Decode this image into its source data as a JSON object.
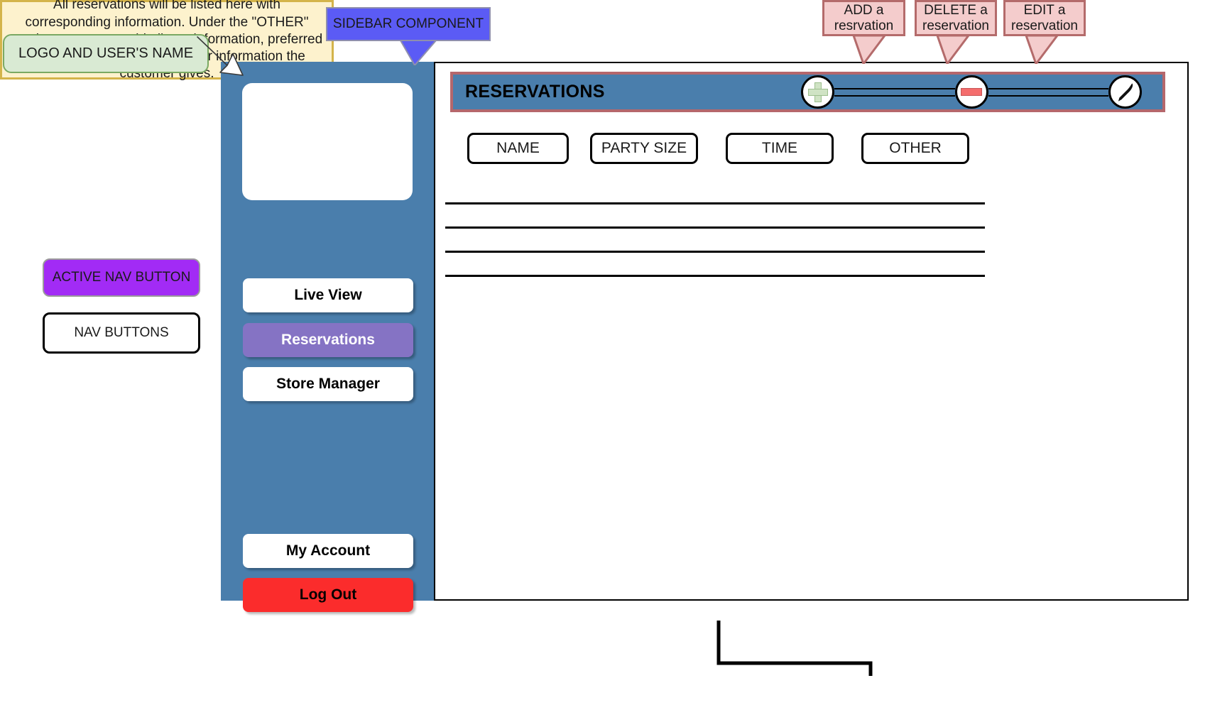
{
  "annotations": {
    "logo_label": "LOGO AND USER'S NAME",
    "sidebar_label": "SIDEBAR COMPONENT",
    "add_label": "ADD a resrvation",
    "delete_label": "DELETE a reservation",
    "edit_label": "EDIT a reservation",
    "legend_active": "ACTIVE NAV BUTTON",
    "legend_nav": "NAV BUTTONS",
    "note": "All reservations will be listed here with corresponding information. Under the \"OTHER\" section, users can add allergy information, preferred seating location, and any other information the customer gives."
  },
  "sidebar": {
    "logo_placeholder": "",
    "items": [
      {
        "label": "Live View",
        "active": false
      },
      {
        "label": "Reservations",
        "active": true
      },
      {
        "label": "Store Manager",
        "active": false
      }
    ],
    "footer_items": [
      {
        "label": "My Account",
        "style": "default"
      },
      {
        "label": "Log Out",
        "style": "logout"
      }
    ]
  },
  "main": {
    "header_title": "RESERVATIONS",
    "actions": [
      {
        "name": "add-reservation",
        "icon": "plus-icon"
      },
      {
        "name": "delete-reservation",
        "icon": "minus-icon"
      },
      {
        "name": "edit-reservation",
        "icon": "pencil-icon"
      }
    ],
    "columns": [
      {
        "label": "NAME"
      },
      {
        "label": "PARTY SIZE"
      },
      {
        "label": "TIME"
      },
      {
        "label": "OTHER"
      }
    ],
    "rows": [
      "",
      "",
      "",
      ""
    ]
  },
  "colors": {
    "sidebar_blue": "#4a7eac",
    "active_nav_purple": "#8573c4",
    "legend_purple": "#a22bf5",
    "logout_red": "#fb2c2c",
    "header_border_rose": "#b5676c",
    "callout_pink": "#f4cccc",
    "callout_blue": "#5b5bf5",
    "callout_green": "#d9ead3",
    "note_yellow": "#fdf2cd"
  }
}
